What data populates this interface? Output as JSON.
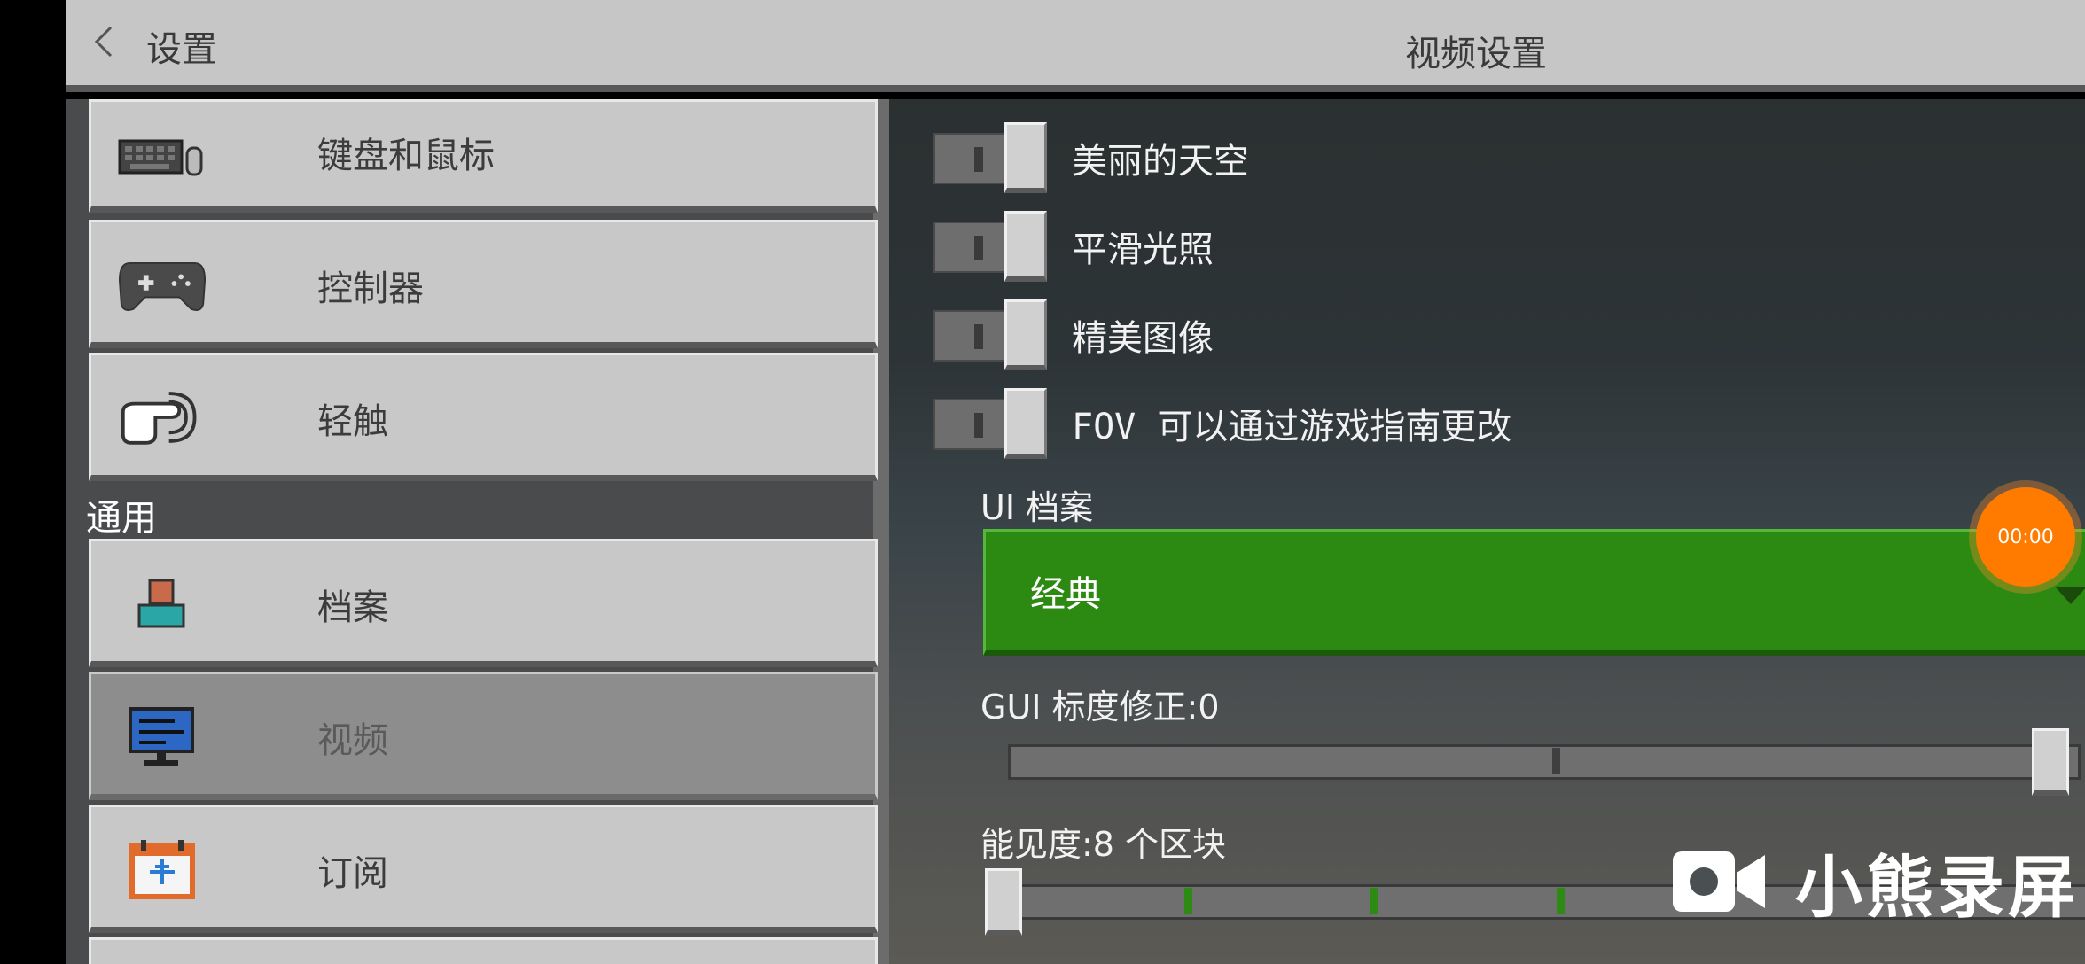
{
  "header": {
    "back_label": "设置",
    "title": "视频设置"
  },
  "sidebar": {
    "items_top": [
      {
        "label": "键盘和鼠标",
        "icon": "keyboard-mouse-icon"
      },
      {
        "label": "控制器",
        "icon": "gamepad-icon"
      },
      {
        "label": "轻触",
        "icon": "touch-icon"
      }
    ],
    "section_general": "通用",
    "items_general": [
      {
        "label": "档案",
        "icon": "profile-icon"
      },
      {
        "label": "视频",
        "icon": "monitor-icon",
        "selected": true
      },
      {
        "label": "订阅",
        "icon": "calendar-add-icon"
      }
    ]
  },
  "settings": {
    "toggles": [
      {
        "label": "美丽的天空",
        "on": false
      },
      {
        "label": "平滑光照",
        "on": false
      },
      {
        "label": "精美图像",
        "on": false
      },
      {
        "label": "FOV 可以通过游戏指南更改",
        "on": false
      }
    ],
    "ui_profile": {
      "label": "UI 档案",
      "value": "经典"
    },
    "gui_scale": {
      "label": "GUI 标度修正:0",
      "value_fraction": 1.0
    },
    "render_distance": {
      "label": "能见度:8 个区块",
      "value_fraction": 0.0
    }
  },
  "overlay": {
    "timer": "00:00",
    "watermark": "小熊录屏"
  },
  "colors": {
    "accent_green": "#2c8a12",
    "recorder_orange": "#ff7b00"
  }
}
